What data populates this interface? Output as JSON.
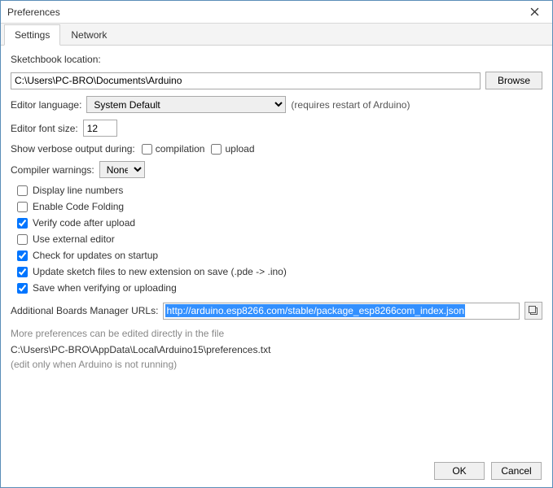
{
  "window": {
    "title": "Preferences"
  },
  "tabs": {
    "settings": "Settings",
    "network": "Network"
  },
  "settings": {
    "sketchbook_label": "Sketchbook location:",
    "sketchbook_path": "C:\\Users\\PC-BRO\\Documents\\Arduino",
    "browse": "Browse",
    "editor_lang_label": "Editor language:",
    "editor_lang_value": "System Default",
    "editor_lang_note": "(requires restart of Arduino)",
    "font_size_label": "Editor font size:",
    "font_size_value": "12",
    "verbose_label": "Show verbose output during:",
    "verbose_compilation": "compilation",
    "verbose_upload": "upload",
    "warnings_label": "Compiler warnings:",
    "warnings_value": "None",
    "opt_display_line_numbers": "Display line numbers",
    "opt_code_folding": "Enable Code Folding",
    "opt_verify_after_upload": "Verify code after upload",
    "opt_external_editor": "Use external editor",
    "opt_check_updates": "Check for updates on startup",
    "opt_update_ext": "Update sketch files to new extension on save (.pde -> .ino)",
    "opt_save_verify": "Save when verifying or uploading",
    "urls_label": "Additional Boards Manager URLs:",
    "urls_value": "http://arduino.esp8266.com/stable/package_esp8266com_index.json",
    "more_prefs": "More preferences can be edited directly in the file",
    "prefs_path": "C:\\Users\\PC-BRO\\AppData\\Local\\Arduino15\\preferences.txt",
    "edit_note": "(edit only when Arduino is not running)"
  },
  "footer": {
    "ok": "OK",
    "cancel": "Cancel"
  }
}
